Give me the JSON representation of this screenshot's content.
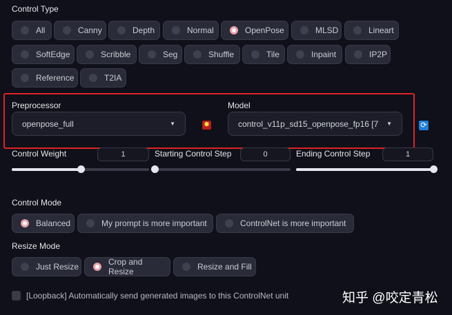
{
  "control_type": {
    "label": "Control Type",
    "options": [
      "All",
      "Canny",
      "Depth",
      "Normal",
      "OpenPose",
      "MLSD",
      "Lineart",
      "SoftEdge",
      "Scribble",
      "Seg",
      "Shuffle",
      "Tile",
      "Inpaint",
      "IP2P",
      "Reference",
      "T2IA"
    ],
    "selected": "OpenPose"
  },
  "preprocessor": {
    "label": "Preprocessor",
    "value": "openpose_full"
  },
  "model": {
    "label": "Model",
    "value": "control_v11p_sd15_openpose_fp16 [7"
  },
  "sliders": [
    {
      "label": "Control Weight",
      "value": "1",
      "fraction": 0.5
    },
    {
      "label": "Starting Control Step",
      "value": "0",
      "fraction": 0
    },
    {
      "label": "Ending Control Step",
      "value": "1",
      "fraction": 1
    }
  ],
  "control_mode": {
    "label": "Control Mode",
    "options": [
      "Balanced",
      "My prompt is more important",
      "ControlNet is more important"
    ],
    "selected": "Balanced"
  },
  "resize_mode": {
    "label": "Resize Mode",
    "options": [
      "Just Resize",
      "Crop and Resize",
      "Resize and Fill"
    ],
    "selected": "Crop and Resize"
  },
  "loopback": {
    "label": "[Loopback] Automatically send generated images to this ControlNet unit",
    "checked": false
  },
  "watermark": "知乎 @咬定青松",
  "colors": {
    "highlight_box": "#e02424",
    "background": "#0f1019"
  }
}
